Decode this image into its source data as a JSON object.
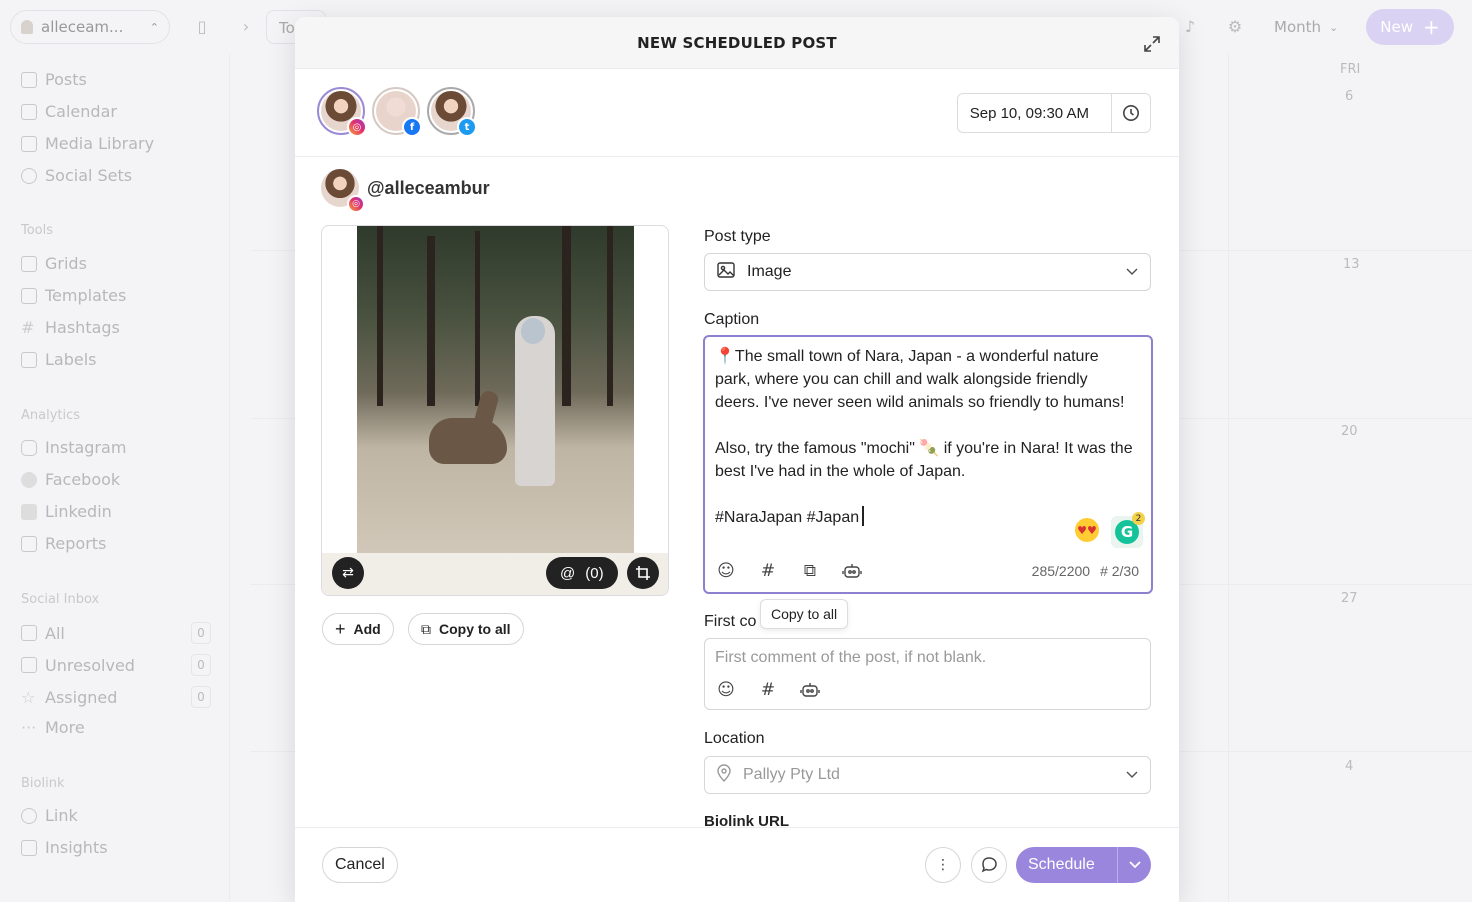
{
  "background": {
    "workspace": "alleceam...",
    "today_button": "To",
    "view_select": "Month",
    "new_button": "New",
    "sidebar": {
      "main_items": [
        "Posts",
        "Calendar",
        "Media Library",
        "Social Sets"
      ],
      "tools_title": "Tools",
      "tools_items": [
        "Grids",
        "Templates",
        "Hashtags",
        "Labels"
      ],
      "analytics_title": "Analytics",
      "analytics_items": [
        "Instagram",
        "Facebook",
        "Linkedin",
        "Reports"
      ],
      "inbox_title": "Social Inbox",
      "inbox_items": [
        {
          "label": "All",
          "count": "0"
        },
        {
          "label": "Unresolved",
          "count": "0"
        },
        {
          "label": "Assigned",
          "count": "0"
        },
        {
          "label": "More",
          "count": ""
        }
      ],
      "biolink_title": "Biolink",
      "biolink_items": [
        "Link",
        "Insights"
      ]
    },
    "calendar": {
      "day_header": "FRI",
      "day_numbers": [
        "6",
        "13",
        "20",
        "27",
        "4"
      ]
    }
  },
  "modal": {
    "title": "NEW SCHEDULED POST",
    "accounts": [
      {
        "network": "instagram",
        "icon": "instagram-icon"
      },
      {
        "network": "facebook",
        "icon": "facebook-icon"
      },
      {
        "network": "twitter",
        "icon": "twitter-icon"
      }
    ],
    "schedule_datetime": "Sep 10, 09:30 AM",
    "profile_handle": "@alleceambur",
    "media": {
      "mentions_label": "(0)",
      "add_label": "Add",
      "copy_all_label": "Copy to all"
    },
    "post_type": {
      "label": "Post type",
      "value": "Image"
    },
    "caption": {
      "label": "Caption",
      "text": "📍The small town of Nara, Japan - a wonderful nature park, where you can chill and walk alongside friendly deers. I've never seen wild animals so friendly to humans!\n\nAlso, try the famous \"mochi\" 🍡 if you're in Nara! It was the best I've had in the whole of Japan.\n\n#NaraJapan #Japan",
      "char_count": "285/2200",
      "hashtag_count": "# 2/30",
      "grammarly_badge": "2"
    },
    "tooltip": "Copy to all",
    "first_comment": {
      "label": "First co",
      "placeholder": "First comment of the post, if not blank."
    },
    "location": {
      "label": "Location",
      "placeholder": "Pallyy Pty Ltd"
    },
    "biolink_label": "Biolink URL",
    "footer": {
      "cancel_label": "Cancel",
      "schedule_label": "Schedule"
    }
  },
  "colors": {
    "accent": "#9a86dc",
    "focus_border": "#8f7fd1"
  }
}
